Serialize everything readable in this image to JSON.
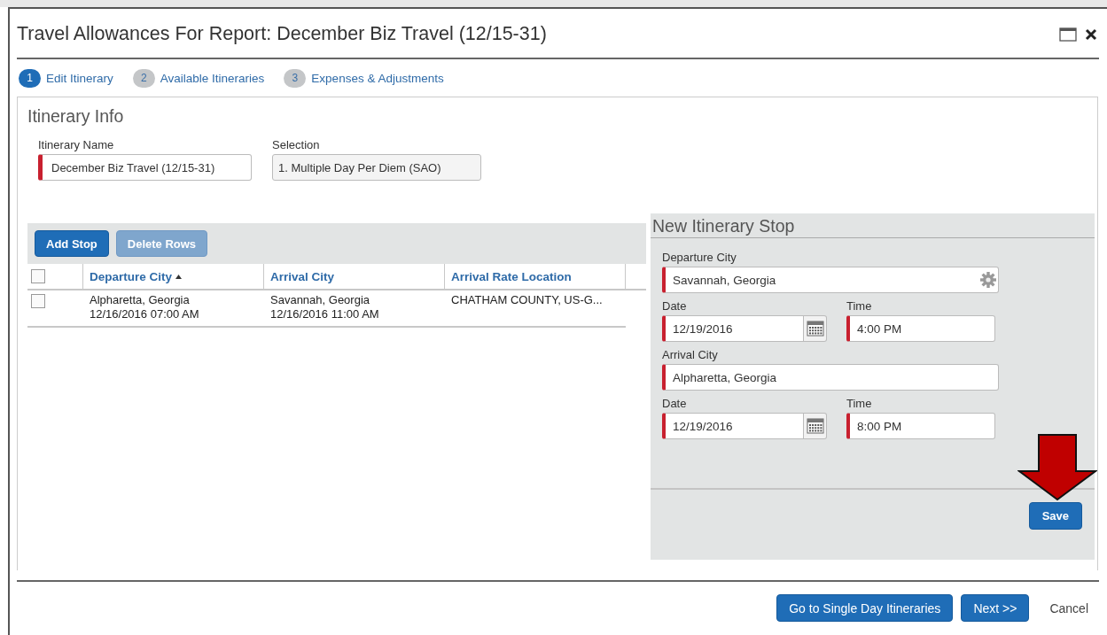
{
  "window": {
    "title": "Travel Allowances For Report: December Biz Travel (12/15-31)"
  },
  "steps": [
    {
      "number": "1",
      "label": "Edit Itinerary",
      "selected": true
    },
    {
      "number": "2",
      "label": "Available Itineraries",
      "selected": false
    },
    {
      "number": "3",
      "label": "Expenses & Adjustments",
      "selected": false
    }
  ],
  "itinerary_info": {
    "heading": "Itinerary Info",
    "fields": [
      {
        "label": "Itinerary Name",
        "value": "December Biz Travel (12/15-31)",
        "required": true,
        "disabled": false
      },
      {
        "label": "Selection",
        "value": "1. Multiple Day Per Diem (SAO)",
        "required": false,
        "disabled": true
      }
    ]
  },
  "toolbar": [
    {
      "label": "Add Stop",
      "disabled": false
    },
    {
      "label": "Delete Rows",
      "disabled": true
    }
  ],
  "table": {
    "select_all_checked": false,
    "columns": [
      {
        "label": "Departure City",
        "sorted": true
      },
      {
        "label": "Arrival City",
        "sorted": false
      },
      {
        "label": "Arrival Rate Location",
        "sorted": false
      }
    ],
    "rows": [
      {
        "checked": false,
        "departure_city": "Alpharetta, Georgia",
        "departure_time": "12/16/2016 07:00 AM",
        "arrival_city": "Savannah, Georgia",
        "arrival_time": "12/16/2016 11:00 AM",
        "arrival_rate_location": "CHATHAM COUNTY, US-G..."
      }
    ]
  },
  "new_stop": {
    "heading": "New Itinerary Stop",
    "fields": [
      {
        "kind": "city",
        "label": "Departure City",
        "value": "Savannah, Georgia",
        "required": true
      },
      {
        "kind": "date",
        "label": "Date",
        "value": "12/19/2016",
        "required": true
      },
      {
        "kind": "time",
        "label": "Time",
        "value": "4:00 PM",
        "required": true
      },
      {
        "kind": "city",
        "label": "Arrival City",
        "value": "Alpharetta, Georgia",
        "required": true
      },
      {
        "kind": "date",
        "label": "Date",
        "value": "12/19/2016",
        "required": true
      },
      {
        "kind": "time",
        "label": "Time",
        "value": "8:00 PM",
        "required": true
      }
    ],
    "save_label": "Save"
  },
  "footer_buttons": [
    {
      "label": "Go to Single Day Itineraries",
      "kind": "primary"
    },
    {
      "label": "Next >>",
      "kind": "primary"
    },
    {
      "label": "Cancel",
      "kind": "link"
    }
  ]
}
